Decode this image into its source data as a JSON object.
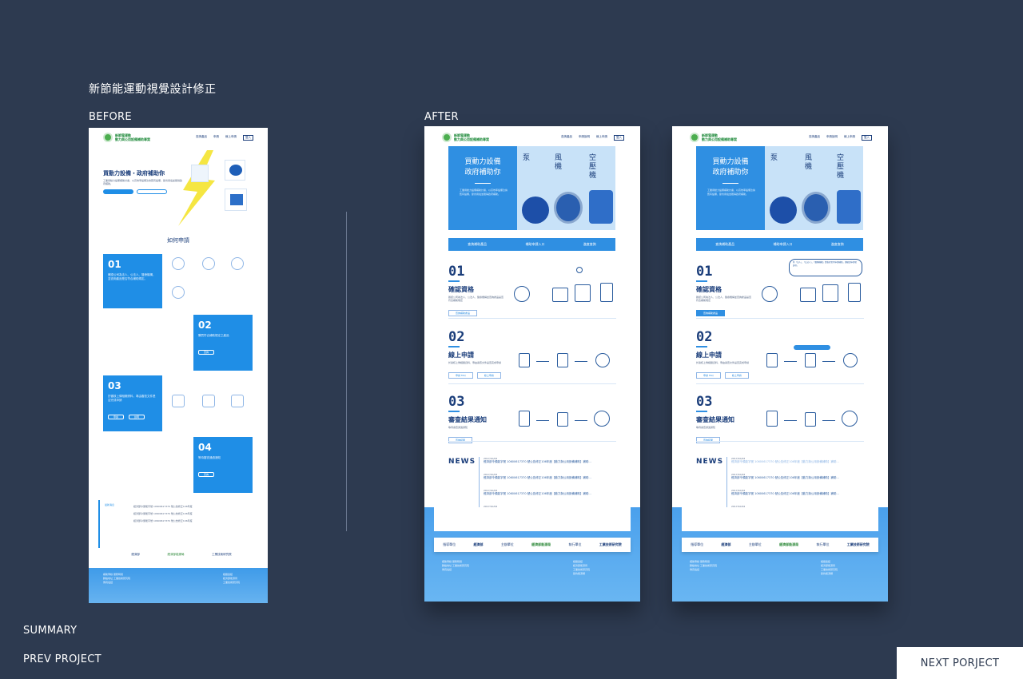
{
  "page_title": "新節能運動視覺設計修正",
  "labels": {
    "before": "BEFORE",
    "after": "AFTER"
  },
  "nav": {
    "summary": "SUMMARY",
    "prev": "PREV PROJECT",
    "next": "NEXT PORJECT"
  },
  "colors": {
    "background": "#2d3a50",
    "primary_blue": "#2f8fe2",
    "navy": "#1a3d7a",
    "green": "#4cae4f"
  },
  "mock": {
    "brand": [
      "新節電運動",
      "動力與公用設備補助專案"
    ],
    "hero_title": [
      "買動力設備",
      "政府補助你"
    ],
    "hero_title_before": "買動力設備・政府補助你",
    "categories": [
      "泵",
      "風機",
      "空壓機"
    ],
    "search_actions": [
      "查詢補助產品",
      "補助申請入口",
      "進度查詢"
    ],
    "how_to": "如何申請",
    "steps": [
      {
        "num": "01",
        "title": "確認資格"
      },
      {
        "num": "02",
        "title": "線上申請"
      },
      {
        "num": "03",
        "title": "審查結果通知"
      }
    ],
    "before_steps": [
      "01",
      "02",
      "03",
      "04"
    ],
    "news_title": "NEWS",
    "news_item": "經濟部令頒能字號 10600617370 號公告修正106年度【動力與公用設備補助】補助...",
    "news_more": "MORE",
    "partners": [
      "指導單位",
      "經濟部",
      "主辦單位",
      "經濟部能源局",
      "執行單位",
      "工業技術研究院"
    ]
  }
}
